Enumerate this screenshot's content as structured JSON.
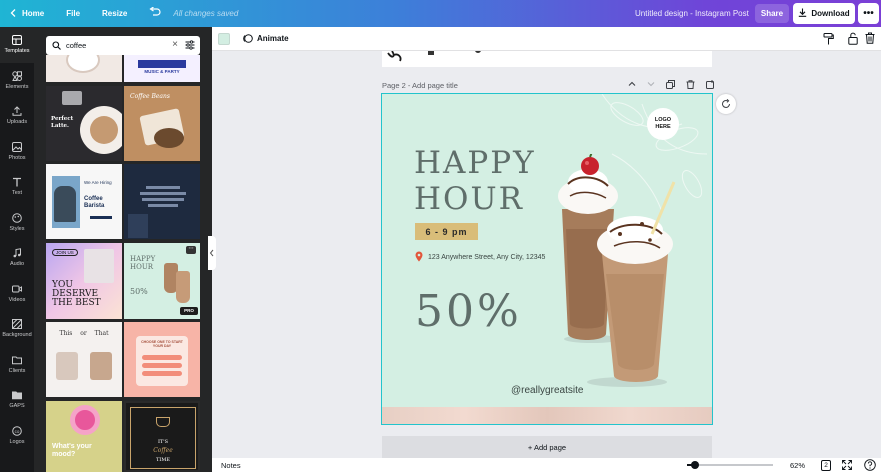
{
  "topbar": {
    "home": "Home",
    "file": "File",
    "resize": "Resize",
    "saved_status": "All changes saved",
    "design_title": "Untitled design - Instagram Post",
    "share": "Share",
    "download": "Download"
  },
  "sidebar": {
    "items": [
      {
        "label": "Templates",
        "icon": "templates-icon"
      },
      {
        "label": "Elements",
        "icon": "elements-icon"
      },
      {
        "label": "Uploads",
        "icon": "upload-icon"
      },
      {
        "label": "Photos",
        "icon": "photo-icon"
      },
      {
        "label": "Text",
        "icon": "text-icon"
      },
      {
        "label": "Styles",
        "icon": "styles-icon"
      },
      {
        "label": "Audio",
        "icon": "audio-icon"
      },
      {
        "label": "Videos",
        "icon": "video-icon"
      },
      {
        "label": "Background",
        "icon": "background-icon"
      },
      {
        "label": "Clients",
        "icon": "folder-icon"
      },
      {
        "label": "GAPS",
        "icon": "folder-icon"
      },
      {
        "label": "Logos",
        "icon": "logo-icon"
      }
    ]
  },
  "search": {
    "value": "coffee"
  },
  "templates": {
    "t_music": "MUSIC & PARTY",
    "t_perfect_latte": "Perfect Latte.",
    "t_coffee_beans": "Coffee Beans",
    "t_hiring_1": "We Are Hiring",
    "t_hiring_2": "Coffee Barista",
    "t_you_deserve": "YOU DESERVE THE BEST",
    "t_join_us": "JOIN US",
    "t_happy_hour": "HAPPY HOUR",
    "t_50": "50%",
    "t_pro": "PRO",
    "t_this_or_that": "This or That",
    "t_choose": "CHOOSE ONE TO START YOUR DAY",
    "t_mood": "What's your mood?",
    "t_coffee_time_1": "IT'S",
    "t_coffee_time_2": "Coffee",
    "t_coffee_time_3": "TIME"
  },
  "toolbar": {
    "animate": "Animate"
  },
  "page": {
    "title": "Page 2 - Add page title",
    "add_page": "+ Add page"
  },
  "design": {
    "headline_1": "HAPPY",
    "headline_2": "HOUR",
    "time": "6 - 9 pm",
    "address": "123 Anywhere Street, Any City, 12345",
    "discount": "50%",
    "handle": "@reallygreatsite",
    "logo_1": "LOGO",
    "logo_2": "HERE"
  },
  "bottombar": {
    "notes": "Notes",
    "zoom": "62%",
    "page_count": "2"
  },
  "colors": {
    "accent": "#7d2ae8",
    "design_bg": "#d4efe3",
    "headline": "#5f6e6a",
    "badge": "#d9bd79"
  }
}
